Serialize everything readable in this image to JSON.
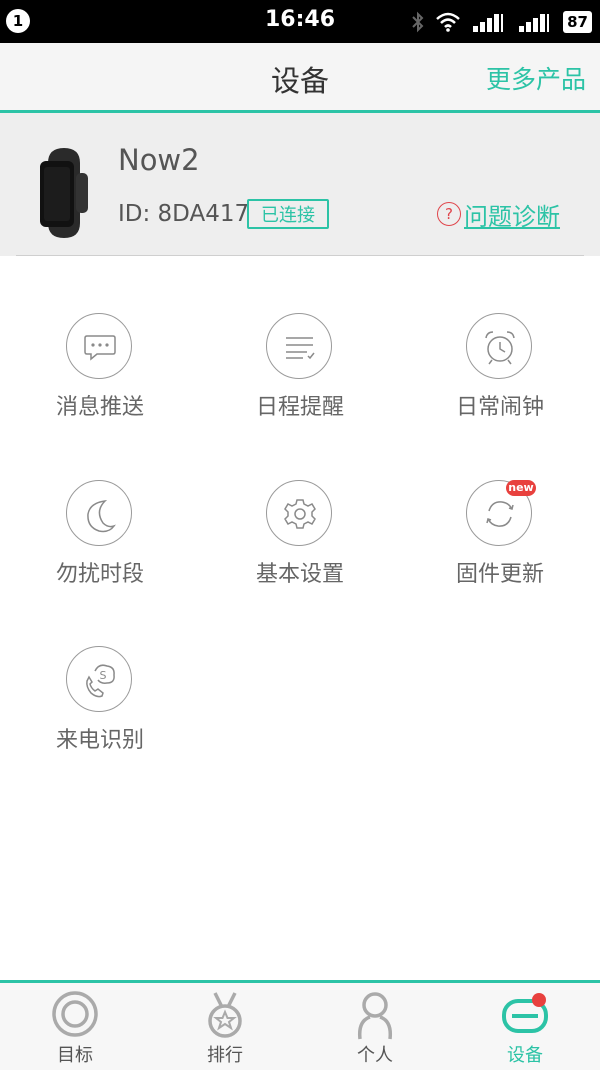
{
  "status_bar": {
    "notification_count": "1",
    "time": "16:46",
    "battery": "87",
    "icons": [
      "bluetooth-icon",
      "wifi-icon",
      "signal-icon",
      "signal-2-icon"
    ]
  },
  "header": {
    "title": "设备",
    "more_label": "更多产品"
  },
  "device": {
    "name": "Now2",
    "id_text": "ID: 8DA417",
    "status_badge": "已连接",
    "diagnose_label": "问题诊断"
  },
  "features": [
    {
      "label": "消息推送",
      "icon": "message-icon"
    },
    {
      "label": "日程提醒",
      "icon": "schedule-icon"
    },
    {
      "label": "日常闹钟",
      "icon": "alarm-clock-icon"
    },
    {
      "label": "勿扰时段",
      "icon": "moon-icon"
    },
    {
      "label": "基本设置",
      "icon": "gear-icon"
    },
    {
      "label": "固件更新",
      "icon": "refresh-icon",
      "badge": "new"
    },
    {
      "label": "来电识别",
      "icon": "phone-icon"
    }
  ],
  "tabs": [
    {
      "label": "目标",
      "icon": "target-icon",
      "active": false
    },
    {
      "label": "排行",
      "icon": "medal-icon",
      "active": false
    },
    {
      "label": "个人",
      "icon": "person-icon",
      "active": false
    },
    {
      "label": "设备",
      "icon": "band-icon",
      "active": true
    }
  ],
  "colors": {
    "accent": "#2cc3a6",
    "alert": "#e8413e",
    "status_bar": "#000000",
    "header_bg": "#f5f5f5",
    "card_bg": "#eeeeee"
  }
}
